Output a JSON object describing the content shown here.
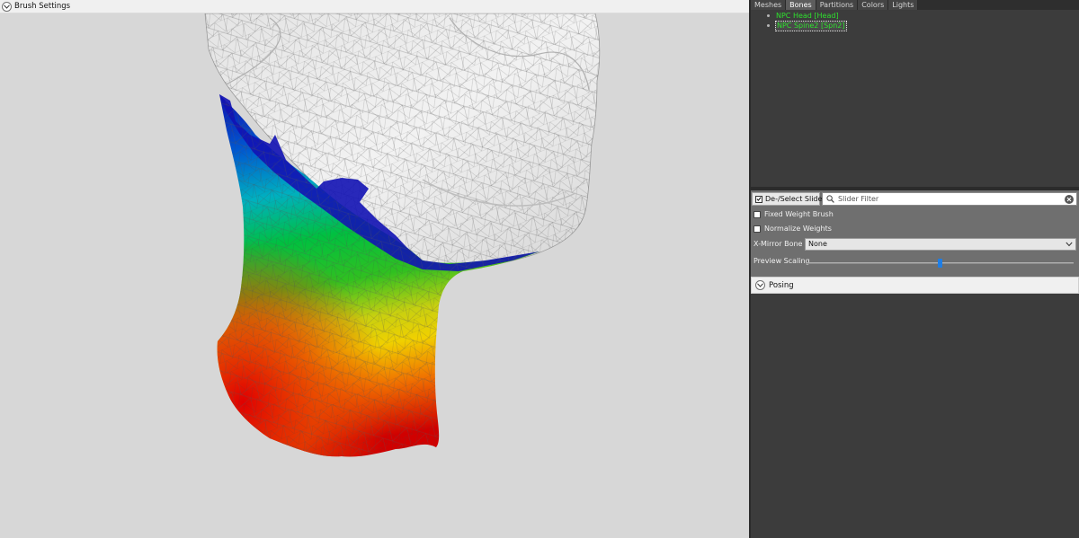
{
  "brush_panel": {
    "header_label": "Brush Settings",
    "toggle_icon": "chevron-down-icon"
  },
  "viewport": {
    "background": "#d7d7d7",
    "mesh_base_color": "#efefef",
    "weight_gradient": [
      "#1010b0",
      "#0060d0",
      "#00b0c0",
      "#00c040",
      "#a0d010",
      "#f0d000",
      "#f07000",
      "#d00000"
    ]
  },
  "tabs": [
    {
      "label": "Meshes",
      "active": false
    },
    {
      "label": "Bones",
      "active": true
    },
    {
      "label": "Partitions",
      "active": false
    },
    {
      "label": "Colors",
      "active": false
    },
    {
      "label": "Lights",
      "active": false
    }
  ],
  "bones": [
    {
      "label": "NPC Head [Head]",
      "selected": false
    },
    {
      "label": "NPC Spine2 [Spn2]",
      "selected": true
    }
  ],
  "controls": {
    "deselect_sliders": {
      "label": "De-/Select Sliders",
      "checked": true
    },
    "filter": {
      "placeholder": "Slider Filter",
      "value": "",
      "search_icon": "search-icon",
      "clear_icon": "clear-icon"
    },
    "fixed_weight": {
      "label": "Fixed Weight Brush",
      "checked": false
    },
    "normalize": {
      "label": "Normalize Weights",
      "checked": false
    },
    "mirror_bone": {
      "label": "X-Mirror Bone",
      "value": "None"
    },
    "preview_scaling": {
      "label": "Preview Scaling",
      "value": 0.5
    }
  },
  "posing": {
    "label": "Posing",
    "toggle_icon": "chevron-down-icon"
  },
  "colors": {
    "bone_text": "#2ee02e",
    "accent": "#1e7ee6"
  }
}
